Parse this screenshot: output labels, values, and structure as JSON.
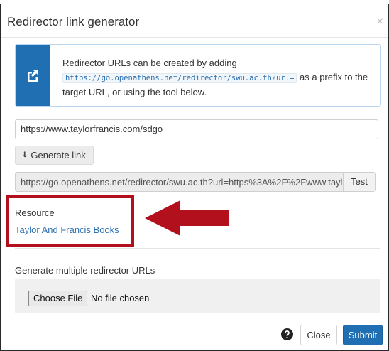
{
  "modal": {
    "title": "Redirector link generator",
    "close_glyph": "×"
  },
  "info": {
    "icon": "external-link-icon",
    "text_before": "Redirector URLs can be created by adding",
    "prefix_code": "https://go.openathens.net/redirector/swu.ac.th?url=",
    "text_after": " as a prefix to the target URL, or using the tool below."
  },
  "generator": {
    "url_value": "https://www.taylorfrancis.com/sdgo",
    "generate_label": "Generate link",
    "generate_icon": "chevrons-down-icon",
    "output_value": "https://go.openathens.net/redirector/swu.ac.th?url=https%3A%2F%2Fwww.taylo",
    "test_label": "Test"
  },
  "resource": {
    "label": "Resource",
    "link_text": "Taylor And Francis Books"
  },
  "annotation": {
    "highlight_color": "#b3101e",
    "arrow_icon": "left-arrow-icon"
  },
  "multiple": {
    "label": "Generate multiple redirector URLs",
    "choose_file_label": "Choose File",
    "file_status": "No file chosen"
  },
  "footer": {
    "help_icon": "question-circle-icon",
    "close_label": "Close",
    "submit_label": "Submit"
  },
  "colors": {
    "primary": "#1f6fb2",
    "link": "#2a6fb0"
  }
}
